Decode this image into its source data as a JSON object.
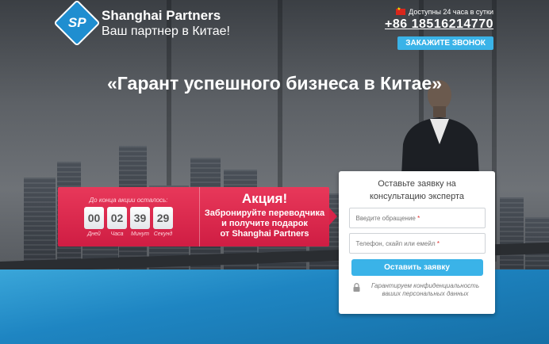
{
  "brand": {
    "logo_initials": "SP",
    "name": "Shanghai Partners",
    "tagline": "Ваш партнер в Китае!",
    "color": "#1f8ed0"
  },
  "contact": {
    "availability": "Доступны 24 часа в сутки",
    "phone": "+86 18516214770",
    "callback_label": "ЗАКАЖИТЕ ЗВОНОК",
    "flag_icon": "china-flag-icon"
  },
  "hero": {
    "headline": "«Гарант успешного бизнеса в Китае»"
  },
  "promo": {
    "countdown_label": "До конца акции осталось:",
    "countdown": [
      {
        "value": "00",
        "unit": "Дней"
      },
      {
        "value": "02",
        "unit": "Часа"
      },
      {
        "value": "39",
        "unit": "Минут"
      },
      {
        "value": "29",
        "unit": "Секунд"
      }
    ],
    "title": "Акция!",
    "text_line1": "Забронируйте переводчика",
    "text_line2": "и получите подарок",
    "text_line3": "от Shanghai Partners",
    "accent_color": "#e02f52"
  },
  "form": {
    "title_line1": "Оставьте заявку на",
    "title_line2": "консультацию эксперта",
    "field1_placeholder": "Введите обращение",
    "field2_placeholder": "Телефон, скайп или емейл",
    "required_mark": "*",
    "submit_label": "Оставить заявку",
    "privacy_line1": "Гарантируем конфиденциальность",
    "privacy_line2": "ваших персональных данных",
    "lock_icon": "lock-icon",
    "button_color": "#3ab3e8"
  }
}
